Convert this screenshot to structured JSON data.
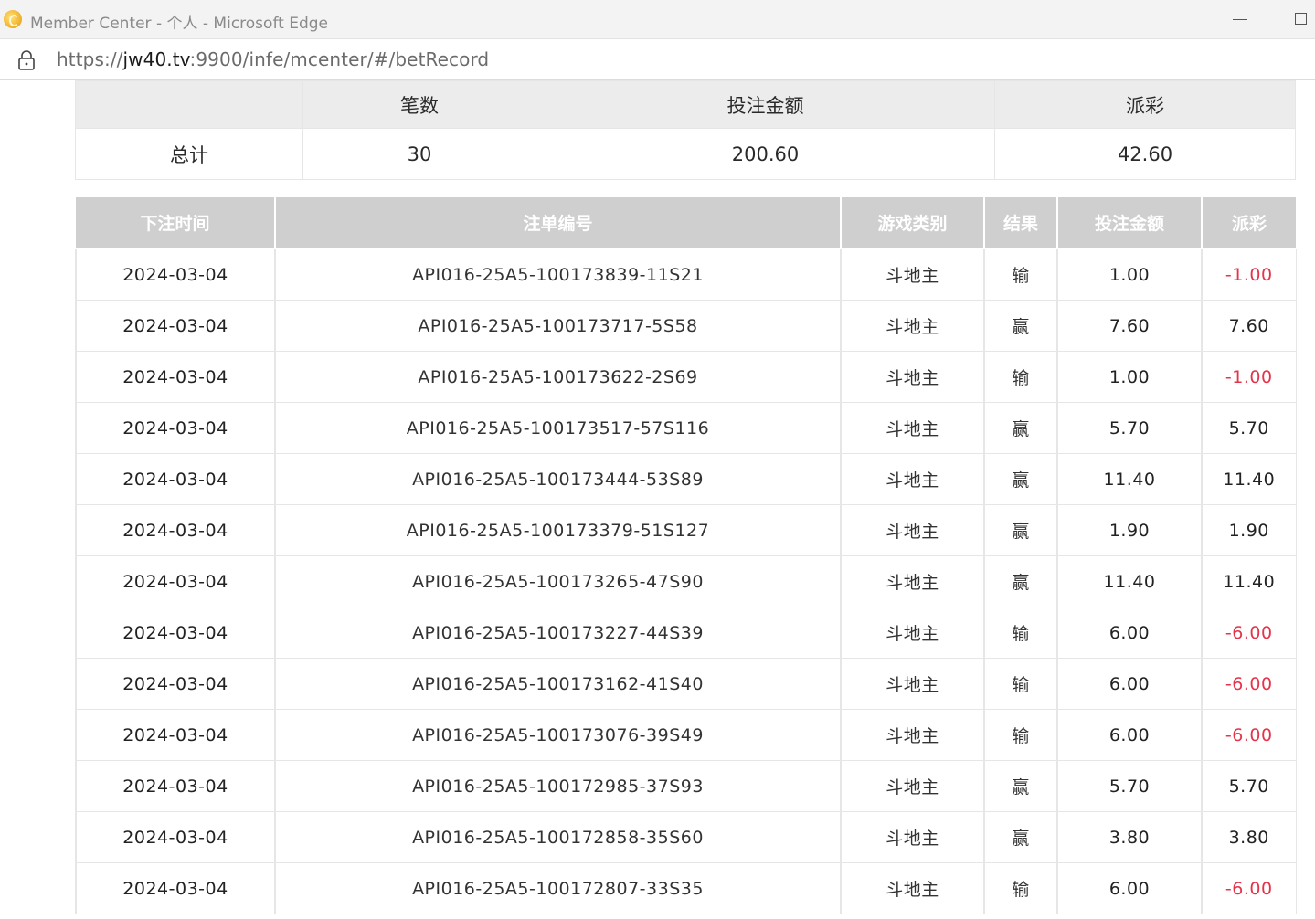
{
  "window": {
    "title": "Member Center - 个人 - Microsoft Edge"
  },
  "address_bar": {
    "url_prefix": "https://",
    "url_host": "jw40.tv",
    "url_rest": ":9900/infe/mcenter/#/betRecord"
  },
  "summary": {
    "headers": [
      "",
      "笔数",
      "投注金额",
      "派彩"
    ],
    "row": {
      "label": "总计",
      "count": "30",
      "bet_amount": "200.60",
      "payout": "42.60"
    }
  },
  "records": {
    "headers": [
      "下注时间",
      "注单编号",
      "游戏类别",
      "结果",
      "投注金额",
      "派彩"
    ],
    "negative_color": "#e5334a",
    "rows": [
      {
        "time": "2024-03-04",
        "order": "API016-25A5-100173839-11S21",
        "game": "斗地主",
        "result": "输",
        "bet": "1.00",
        "payout": "-1.00"
      },
      {
        "time": "2024-03-04",
        "order": "API016-25A5-100173717-5S58",
        "game": "斗地主",
        "result": "赢",
        "bet": "7.60",
        "payout": "7.60"
      },
      {
        "time": "2024-03-04",
        "order": "API016-25A5-100173622-2S69",
        "game": "斗地主",
        "result": "输",
        "bet": "1.00",
        "payout": "-1.00"
      },
      {
        "time": "2024-03-04",
        "order": "API016-25A5-100173517-57S116",
        "game": "斗地主",
        "result": "赢",
        "bet": "5.70",
        "payout": "5.70"
      },
      {
        "time": "2024-03-04",
        "order": "API016-25A5-100173444-53S89",
        "game": "斗地主",
        "result": "赢",
        "bet": "11.40",
        "payout": "11.40"
      },
      {
        "time": "2024-03-04",
        "order": "API016-25A5-100173379-51S127",
        "game": "斗地主",
        "result": "赢",
        "bet": "1.90",
        "payout": "1.90"
      },
      {
        "time": "2024-03-04",
        "order": "API016-25A5-100173265-47S90",
        "game": "斗地主",
        "result": "赢",
        "bet": "11.40",
        "payout": "11.40"
      },
      {
        "time": "2024-03-04",
        "order": "API016-25A5-100173227-44S39",
        "game": "斗地主",
        "result": "输",
        "bet": "6.00",
        "payout": "-6.00"
      },
      {
        "time": "2024-03-04",
        "order": "API016-25A5-100173162-41S40",
        "game": "斗地主",
        "result": "输",
        "bet": "6.00",
        "payout": "-6.00"
      },
      {
        "time": "2024-03-04",
        "order": "API016-25A5-100173076-39S49",
        "game": "斗地主",
        "result": "输",
        "bet": "6.00",
        "payout": "-6.00"
      },
      {
        "time": "2024-03-04",
        "order": "API016-25A5-100172985-37S93",
        "game": "斗地主",
        "result": "赢",
        "bet": "5.70",
        "payout": "5.70"
      },
      {
        "time": "2024-03-04",
        "order": "API016-25A5-100172858-35S60",
        "game": "斗地主",
        "result": "赢",
        "bet": "3.80",
        "payout": "3.80"
      },
      {
        "time": "2024-03-04",
        "order": "API016-25A5-100172807-33S35",
        "game": "斗地主",
        "result": "输",
        "bet": "6.00",
        "payout": "-6.00"
      }
    ]
  }
}
